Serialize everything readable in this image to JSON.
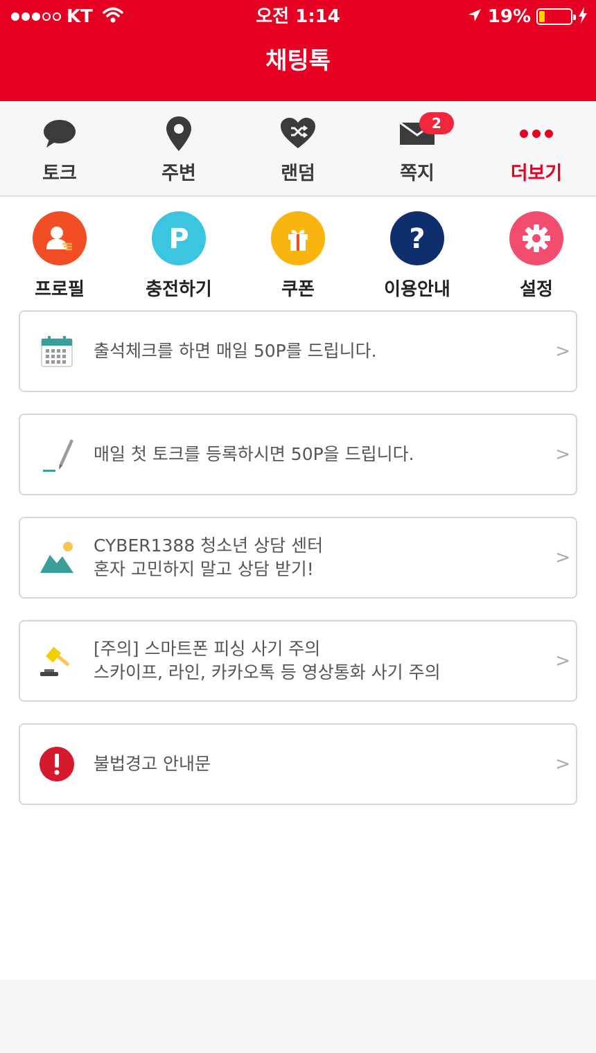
{
  "status_bar": {
    "carrier": "KT",
    "time": "오전 1:14",
    "battery_percent": "19%",
    "battery_level": 0.19,
    "signal_bars": 3,
    "signal_total": 5
  },
  "header": {
    "title": "채팅톡",
    "color": "#e60022"
  },
  "tabs": [
    {
      "label": "토크",
      "icon": "speech-bubble-icon"
    },
    {
      "label": "주변",
      "icon": "location-pin-icon"
    },
    {
      "label": "랜덤",
      "icon": "shuffle-heart-icon"
    },
    {
      "label": "쪽지",
      "icon": "envelope-icon",
      "badge": "2"
    },
    {
      "label": "더보기",
      "icon": "more-dots-icon",
      "active": true
    }
  ],
  "quick_menu": [
    {
      "label": "프로필",
      "icon": "profile-icon",
      "color": "#f24e26"
    },
    {
      "label": "충전하기",
      "icon": "points-icon",
      "color": "#3cc5e0"
    },
    {
      "label": "쿠폰",
      "icon": "gift-icon",
      "color": "#f9b50d"
    },
    {
      "label": "이용안내",
      "icon": "help-icon",
      "color": "#0f2e6e"
    },
    {
      "label": "설정",
      "icon": "gear-icon",
      "color": "#f24c6f"
    }
  ],
  "notices": [
    {
      "lines": [
        "출석체크를 하면 매일 50P를 드립니다."
      ],
      "icon": "calendar-icon"
    },
    {
      "lines": [
        "매일 첫 토크를 등록하시면 50P을 드립니다."
      ],
      "icon": "pencil-icon"
    },
    {
      "lines": [
        "CYBER1388 청소년 상담 센터",
        "혼자 고민하지 말고 상담 받기!"
      ],
      "icon": "mountain-sun-icon"
    },
    {
      "lines": [
        "[주의] 스마트폰 피싱 사기 주의",
        "스카이프, 라인, 카카오톡 등 영상통화 사기 주의"
      ],
      "icon": "gavel-icon"
    },
    {
      "lines": [
        "불법경고 안내문"
      ],
      "icon": "warning-icon"
    }
  ],
  "chevron": ">"
}
